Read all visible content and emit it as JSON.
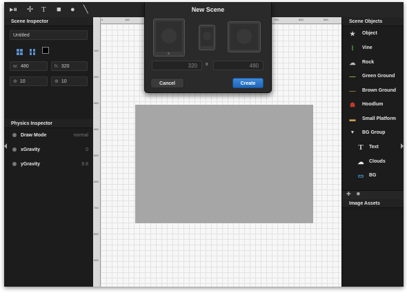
{
  "toolbar": {
    "tools": [
      {
        "name": "play-pause-icon",
        "glyph": "▸⏸"
      },
      {
        "name": "pen-tool-icon",
        "glyph": "✢"
      },
      {
        "name": "text-tool-icon",
        "glyph": "T"
      },
      {
        "name": "rectangle-tool-icon",
        "glyph": "■"
      },
      {
        "name": "circle-tool-icon",
        "glyph": "●"
      },
      {
        "name": "line-tool-icon",
        "glyph": "╲"
      }
    ]
  },
  "scene_inspector": {
    "title": "Scene Inspector",
    "name_value": "Untitled",
    "w_label": "w:",
    "w_value": "480",
    "h_label": "h:",
    "h_value": "320",
    "x_label": "⊕",
    "x_value": "10",
    "y_label": "⊕",
    "y_value": "10"
  },
  "physics_inspector": {
    "title": "Physics Inspector",
    "rows": [
      {
        "label": "Draw Mode",
        "value": "normal"
      },
      {
        "label": "xGravity",
        "value": "0"
      },
      {
        "label": "yGravity",
        "value": "9.8"
      }
    ]
  },
  "scene_objects": {
    "title": "Scene Objects",
    "items": [
      {
        "label": "Object",
        "icon": "star-icon",
        "glyph": "★"
      },
      {
        "label": "Vine",
        "icon": "vine-icon",
        "glyph": "⌇"
      },
      {
        "label": "Rock",
        "icon": "rock-icon",
        "glyph": "☁"
      },
      {
        "label": "Green Ground",
        "icon": "green-ground-icon",
        "glyph": "—"
      },
      {
        "label": "Brown Ground",
        "icon": "brown-ground-icon",
        "glyph": "—"
      },
      {
        "label": "Hoodlum",
        "icon": "hoodlum-icon",
        "glyph": "☗"
      },
      {
        "label": "Small Platform",
        "icon": "small-platform-icon",
        "glyph": "▬"
      },
      {
        "label": "BG Group",
        "icon": "disclosure-triangle-icon",
        "glyph": "▼"
      },
      {
        "label": "Text",
        "icon": "text-icon",
        "glyph": "T"
      },
      {
        "label": "Clouds",
        "icon": "clouds-icon",
        "glyph": "☁"
      },
      {
        "label": "BG",
        "icon": "bg-image-icon",
        "glyph": "▭"
      }
    ]
  },
  "image_assets": {
    "title": "Image Assets"
  },
  "modal": {
    "title": "New Scene",
    "width_value": "320",
    "times": "x",
    "height_value": "480",
    "cancel_label": "Cancel",
    "create_label": "Create"
  },
  "ruler_h": [
    "0",
    "100",
    "200",
    "300",
    "400",
    "500",
    "600",
    "700",
    "800",
    "900"
  ],
  "ruler_v": [
    "100",
    "200",
    "300",
    "400",
    "500",
    "600",
    "700",
    "800",
    "900"
  ],
  "colors": {
    "create_button": "#1f66b8",
    "scene_rect": "#a6a6a6",
    "panel_bg": "#1c1c1c"
  }
}
